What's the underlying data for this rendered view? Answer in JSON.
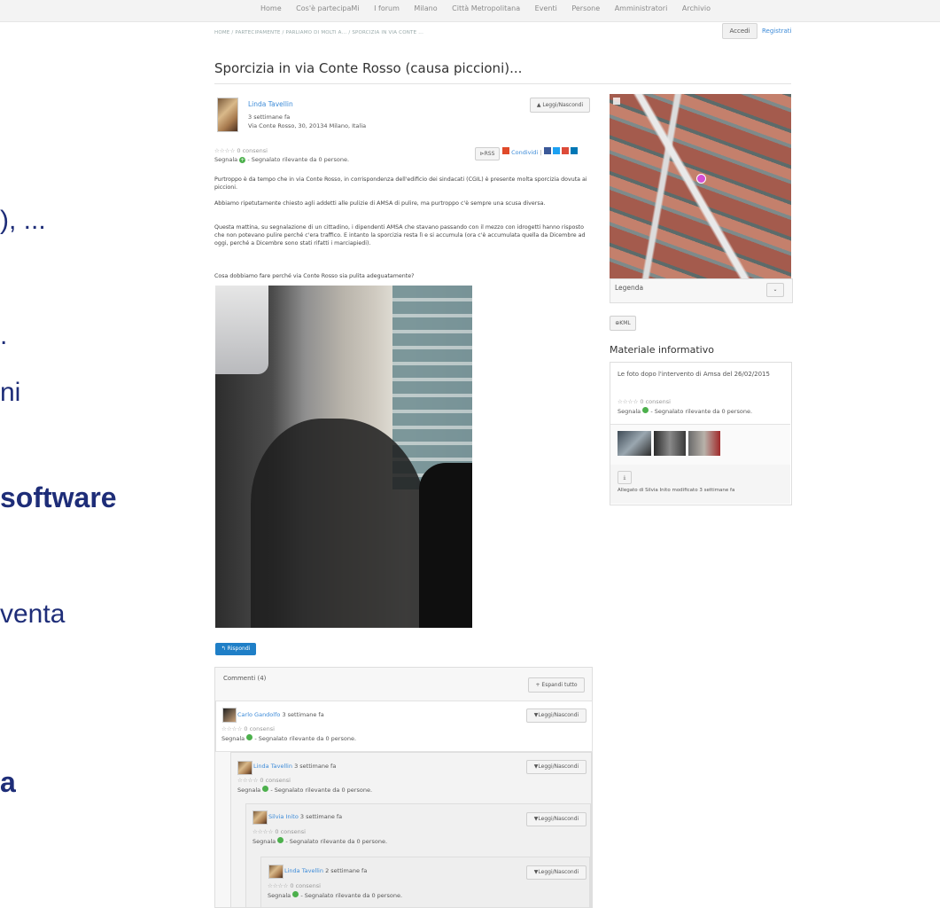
{
  "nav": {
    "items": [
      "Home",
      "Cos'è partecipaMi",
      "I forum",
      "Milano",
      "Città Metropolitana",
      "Eventi",
      "Persone",
      "Amministratori",
      "Archivio"
    ]
  },
  "breadcrumb": "HOME / PARTECIPAMENTE / PARLIAMO DI MOLTI A... / SPORCIZIA IN VIA CONTE ...",
  "auth": {
    "login": "Accedi",
    "register": "Registrati"
  },
  "post": {
    "title": "Sporcizia in via Conte Rosso (causa piccioni)...",
    "author": "Linda Tavellin",
    "time": "3 settimane fa",
    "address": "Via Conte Rosso, 30, 20134 Milano, Italia",
    "toggle": "Leggi/Nascondi",
    "consensi": "☆☆☆☆ 0 consensi",
    "segnala": "Segnala",
    "segnalato": "- Segnalato rilevante da 0 persone.",
    "rss": "RSS",
    "condividi": "Condividi",
    "paragraphs": [
      "Purtroppo è da tempo che in via Conte Rosso, in corrispondenza dell'edificio dei sindacati (CGIL) è presente molta sporcizia dovuta ai piccioni.",
      "Abbiamo ripetutamente chiesto agli addetti alle pulizie di AMSA di pulire, ma purtroppo c'è sempre una scusa diversa.",
      "Questa mattina, su segnalazione di un cittadino, i dipendenti AMSA che stavano passando con il mezzo con idrogetti hanno risposto che non potevano pulire perché c'era traffico. E intanto la sporcizia resta lì e si accumula (ora c'è accumulata quella da Dicembre ad oggi, perché a Dicembre sono stati rifatti i marciapiedi).",
      "Cosa dobbiamo fare perché via Conte Rosso sia pulita adeguatamente?"
    ],
    "reply": "Rispondi"
  },
  "comments": {
    "header": "Commenti (4)",
    "expand": "+ Espandi tutto",
    "items": [
      {
        "author": "Carlo Gandolfo",
        "time": "3 settimane fa"
      },
      {
        "author": "Linda Tavellin",
        "time": "3 settimane fa"
      },
      {
        "author": "Silvia Inito",
        "time": "3 settimane fa"
      },
      {
        "author": "Linda Tavellin",
        "time": "2 settimane fa"
      }
    ],
    "toggle": "Leggi/Nascondi",
    "consensi": "☆☆☆☆ 0 consensi",
    "segnala": "Segnala",
    "segnalato": "- Segnalato rilevante da 0 persone."
  },
  "sidebar": {
    "legend": "Legenda",
    "kml": "KML",
    "material_title": "Materiale informativo",
    "material_item": "Le foto dopo l'intervento di Amsa del 26/02/2015",
    "consensi": "☆☆☆☆ 0 consensi",
    "segnala": "Segnala",
    "segnalato": "- Segnalato rilevante da 0 persone.",
    "attachment": "Allegato di Silvia Inito modificato 3 settimane fa"
  },
  "slide": {
    "l1": "), ...",
    "l2": ".",
    "l3": "ni",
    "l4": "software",
    "l5": "venta",
    "l6": "a"
  }
}
